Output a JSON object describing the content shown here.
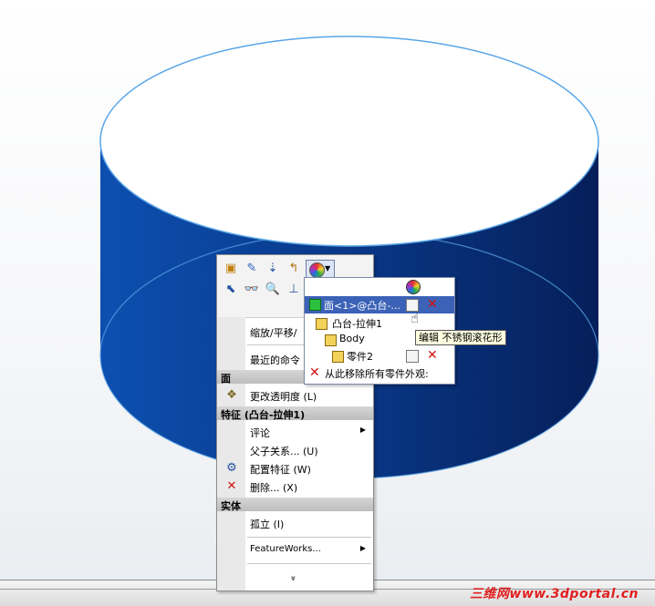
{
  "context_menu": {
    "toolbar_icons": [
      "edit-sketch-icon",
      "edit-feature-icon",
      "rollback-icon",
      "return-icon",
      "appearance-icon",
      "select-other-icon",
      "hide-show-icon",
      "zoom-to-selection-icon",
      "normal-to-icon"
    ],
    "items": {
      "zoom_pan": "缩放/平移/",
      "recent": "最近的命令",
      "face_header": "面",
      "transparency": "更改透明度",
      "transparency_key": "(L)",
      "feature_header": "特征 (凸台-拉伸1)",
      "comment": "评论",
      "parent_child": "父子关系...",
      "parent_child_key": "(U)",
      "config_feature": "配置特征",
      "config_feature_key": "(W)",
      "delete": "删除...",
      "delete_key": "(X)",
      "body_header": "实体",
      "isolate": "孤立",
      "isolate_key": "(I)",
      "featureworks": "FeatureWorks...",
      "more": "»"
    }
  },
  "flyout": {
    "face": "面<1>@凸台-...",
    "feature": "凸台-拉伸1",
    "body": "Body",
    "part": "零件2",
    "remove_all": "从此移除所有零件外观:"
  },
  "tooltip": "编辑  不锈钢滚花形",
  "watermark": "三维网www.3dportal.cn",
  "colors": {
    "cylinder_dark": "#0a2f78",
    "cylinder_light": "#0d4fb0",
    "edge": "#5aa6e8",
    "selection": "#3b62b7"
  }
}
